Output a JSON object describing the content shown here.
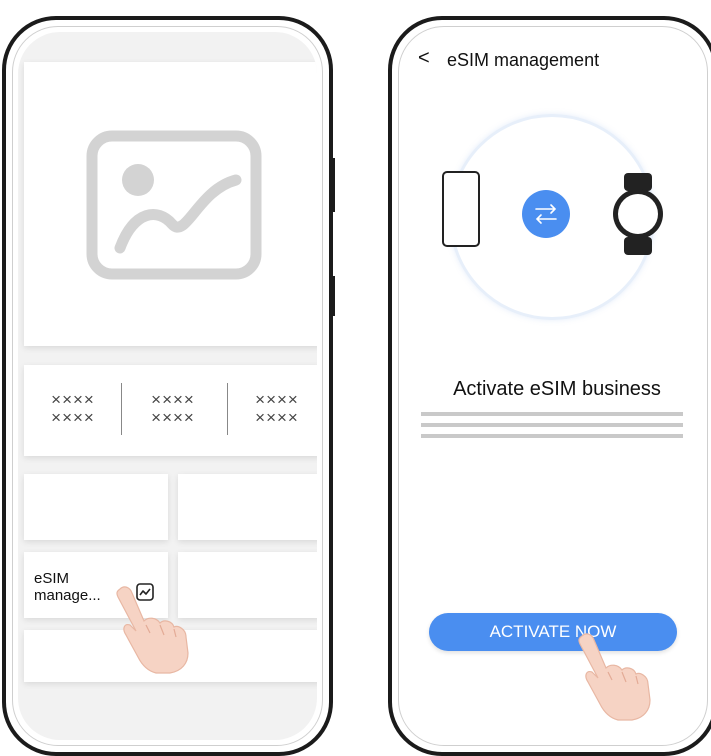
{
  "left_screen": {
    "stats": [
      {
        "line1": "××××",
        "line2": "××××"
      },
      {
        "line1": "××××",
        "line2": "××××"
      },
      {
        "line1": "××××",
        "line2": "××××"
      }
    ],
    "esim_tile": {
      "label": "eSIM\nmanage...",
      "icon": "chart-icon"
    }
  },
  "right_screen": {
    "back_label": "<",
    "title": "eSIM management",
    "heading": "Activate eSIM business",
    "button_label": "ACTIVATE NOW",
    "accent_color": "#4a8ef0"
  }
}
